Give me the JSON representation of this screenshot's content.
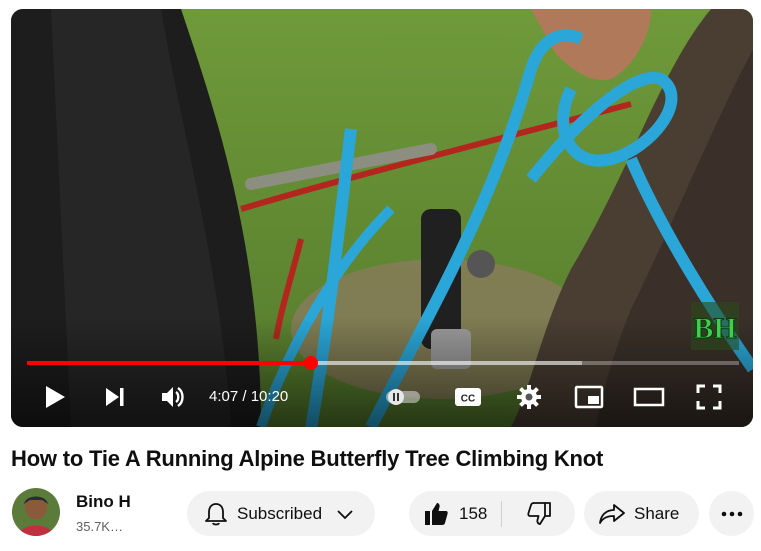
{
  "player": {
    "current_time": "4:07",
    "duration": "10:20",
    "time_separator": "/",
    "progress_fraction": 0.3984,
    "buffered_fraction": 0.78,
    "accent": "#ff0000",
    "watermark_text": "BH",
    "controls": {
      "play": "play-icon",
      "next": "next-icon",
      "volume": "volume-icon",
      "autoplay": "autoplay-toggle-icon",
      "captions": "captions-icon",
      "settings": "gear-icon",
      "miniplayer": "miniplayer-icon",
      "theater": "theater-icon",
      "fullscreen": "fullscreen-icon"
    }
  },
  "video": {
    "title": "How to Tie A Running Alpine Butterfly Tree Climbing Knot"
  },
  "channel": {
    "name": "Bino H",
    "subscribers": "35.7K…"
  },
  "actions": {
    "subscribe_label": "Subscribed",
    "likes": "158",
    "share_label": "Share",
    "more_icon": "more-icon"
  }
}
